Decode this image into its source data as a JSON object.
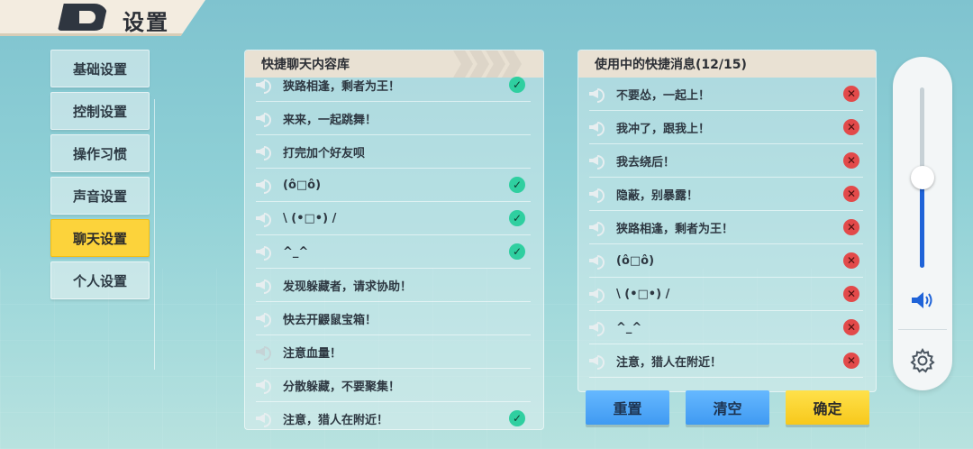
{
  "header": {
    "title": "设置"
  },
  "sidebar": {
    "items": [
      {
        "label": "基础设置"
      },
      {
        "label": "控制设置"
      },
      {
        "label": "操作习惯"
      },
      {
        "label": "声音设置"
      },
      {
        "label": "聊天设置",
        "active": true
      },
      {
        "label": "个人设置"
      }
    ]
  },
  "library": {
    "title": "快捷聊天内容库",
    "items": [
      {
        "text": "狭路相逢，剩者为王！",
        "checked": true
      },
      {
        "text": "来来，一起跳舞！",
        "checked": false
      },
      {
        "text": "打完加个好友呗",
        "checked": false
      },
      {
        "text": "(ô□ô)",
        "checked": true
      },
      {
        "text": "\\ (•□•) /",
        "checked": true
      },
      {
        "text": "^_^",
        "checked": true
      },
      {
        "text": "发现躲藏者，请求协助！",
        "checked": false
      },
      {
        "text": "快去开鼹鼠宝箱！",
        "checked": false
      },
      {
        "text": "注意血量！",
        "checked": false
      },
      {
        "text": "分散躲藏，不要聚集！",
        "checked": false
      },
      {
        "text": "注意，猎人在附近！",
        "checked": true
      }
    ]
  },
  "inuse": {
    "title": "使用中的快捷消息(12/15)",
    "items": [
      {
        "text": "不要怂，一起上！"
      },
      {
        "text": "我冲了，跟我上！"
      },
      {
        "text": "我去绕后！"
      },
      {
        "text": "隐蔽，别暴露！"
      },
      {
        "text": "狭路相逢，剩者为王！"
      },
      {
        "text": "(ô□ô)"
      },
      {
        "text": "\\ (•□•) /"
      },
      {
        "text": "^_^"
      },
      {
        "text": "注意，猎人在附近！"
      }
    ]
  },
  "buttons": {
    "reset": "重置",
    "clear": "清空",
    "confirm": "确定"
  },
  "volume": {
    "level": 0.5
  },
  "colors": {
    "accent": "#fcd33b",
    "check": "#2fcfa0",
    "remove": "#e24a4a",
    "button_blue": "#4fa6f7"
  }
}
